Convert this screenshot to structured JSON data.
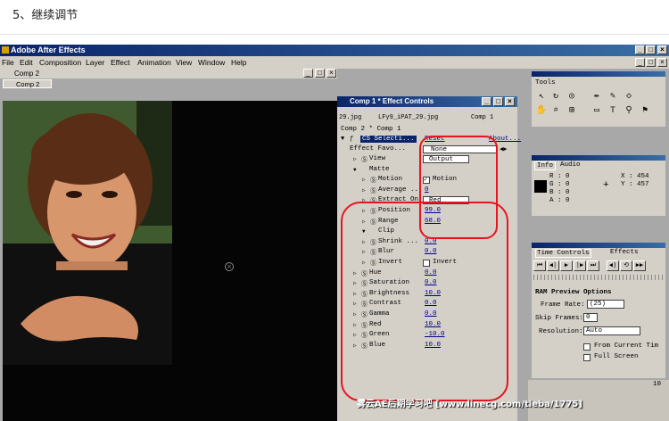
{
  "heading": "5、继续调节",
  "app": {
    "title": "Adobe After Effects",
    "controls": [
      "_",
      "□",
      "×"
    ],
    "doc_controls": [
      "_",
      "□",
      "×"
    ]
  },
  "menu": [
    "File",
    "Edit",
    "Composition",
    "Layer",
    "Effect",
    "Animation",
    "View",
    "Window",
    "Help"
  ],
  "comp": {
    "window_title": "Comp 2",
    "tab": "Comp 2",
    "win_buttons": [
      "_",
      "□",
      "×"
    ]
  },
  "effect_controls": {
    "title": "Comp 1 * Effect Controls",
    "tabs": [
      "29.jpg",
      "LFy9_iPAT_29.jpg",
      "Comp 1"
    ],
    "breadcrumb": "Comp 2 * Comp 1",
    "effect_name": "CS Selecti...",
    "reset": "Reset",
    "about": "About...",
    "favorites_label": "Effect Favo...",
    "favorites_value": "None",
    "rows": [
      {
        "name": "View",
        "value": "Output",
        "kind": "dropdown",
        "indent": 0
      },
      {
        "name": "Matte",
        "value": "",
        "kind": "group",
        "indent": 0
      },
      {
        "name": "Motion",
        "value": "Motion",
        "kind": "check",
        "indent": 1
      },
      {
        "name": "Average ...",
        "value": "0",
        "kind": "num",
        "indent": 1
      },
      {
        "name": "Extract On",
        "value": "Red",
        "kind": "dropdown",
        "indent": 1
      },
      {
        "name": "Position",
        "value": "99.0",
        "kind": "num",
        "indent": 1
      },
      {
        "name": "Range",
        "value": "68.0",
        "kind": "num",
        "indent": 1
      },
      {
        "name": "Clip",
        "value": "",
        "kind": "group",
        "indent": 1
      },
      {
        "name": "Shrink ...",
        "value": "0.0",
        "kind": "num",
        "indent": 1
      },
      {
        "name": "Blur",
        "value": "0.0",
        "kind": "num",
        "indent": 1
      },
      {
        "name": "Invert",
        "value": "Invert",
        "kind": "check",
        "indent": 1
      },
      {
        "name": "Hue",
        "value": "0.0",
        "kind": "num",
        "indent": 0
      },
      {
        "name": "Saturation",
        "value": "0.0",
        "kind": "num",
        "indent": 0
      },
      {
        "name": "Brightness",
        "value": "10.0",
        "kind": "num",
        "indent": 0
      },
      {
        "name": "Contrast",
        "value": "0.0",
        "kind": "num",
        "indent": 0
      },
      {
        "name": "Gamma",
        "value": "0.0",
        "kind": "num",
        "indent": 0
      },
      {
        "name": "Red",
        "value": "10.0",
        "kind": "num",
        "indent": 0
      },
      {
        "name": "Green",
        "value": "-10.0",
        "kind": "num",
        "indent": 0
      },
      {
        "name": "Blue",
        "value": "10.0",
        "kind": "num",
        "indent": 0
      }
    ]
  },
  "tools": {
    "title": "Tools"
  },
  "info": {
    "tabs": [
      "Info",
      "Audio"
    ],
    "r": "R : 0",
    "g": "G : 0",
    "b": "B : 0",
    "a": "A : 0",
    "x": "X : 454",
    "y": "Y : 457"
  },
  "time_controls": {
    "tabs": [
      "Time Controls",
      "Effects"
    ],
    "ram_title": "RAM Preview Options",
    "frame_rate_label": "Frame Rate:",
    "frame_rate": "(25)",
    "skip_label": "Skip Frames:",
    "skip": "0",
    "resolution_label": "Resolution:",
    "resolution": "Auto",
    "from_current": "From Current Tim",
    "full_screen": "Full Screen"
  },
  "bottom_value": "10",
  "watermark": "雾云AE后期学习吧 [www.linecg.com/tieba/1775]",
  "colors": {
    "annotation": "#e8141e",
    "titlebar": "#0a246a",
    "panel": "#d4d0c8"
  }
}
